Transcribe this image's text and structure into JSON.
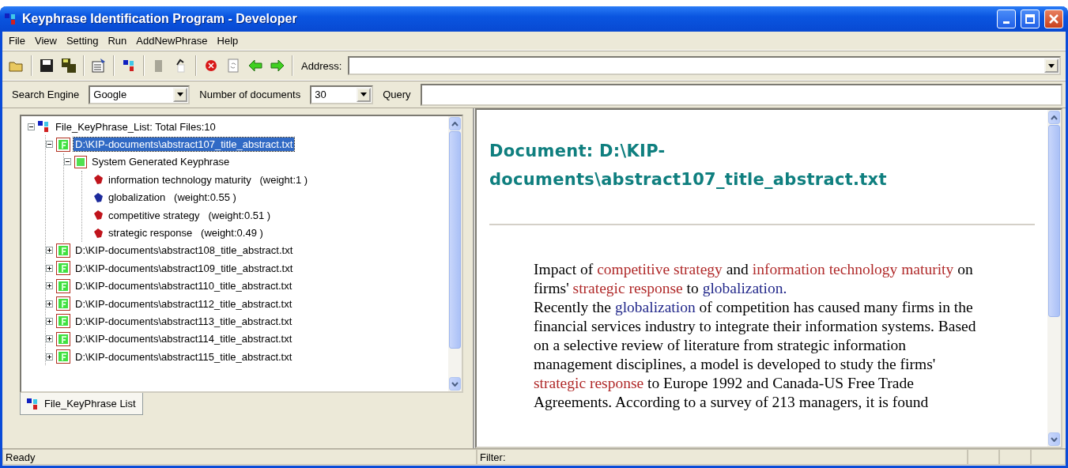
{
  "window": {
    "title": "Keyphrase Identification Program - Developer"
  },
  "menu": [
    "File",
    "View",
    "Setting",
    "Run",
    "AddNewPhrase",
    "Help"
  ],
  "address": {
    "label": "Address:"
  },
  "search": {
    "engine_label": "Search Engine",
    "engine": "Google",
    "count_label": "Number of documents",
    "count": "30",
    "query_label": "Query"
  },
  "tree": {
    "label": "File_KeyPhrase_List: Total Files:10",
    "expanded": true,
    "children": [
      {
        "kind": "file",
        "label": "D:\\KIP-documents\\abstract107_title_abstract.txt",
        "expanded": true,
        "selected": true,
        "children": [
          {
            "kind": "group",
            "label": "System Generated Keyphrase",
            "expanded": true,
            "selected": false,
            "children": [
              {
                "kind": "keyphrase",
                "label": "information technology maturity   (weight:1 )",
                "color": "#c0141c",
                "selected": false
              },
              {
                "kind": "keyphrase",
                "label": "globalization   (weight:0.55 )",
                "color": "#1c2a9c",
                "selected": false
              },
              {
                "kind": "keyphrase",
                "label": "competitive strategy   (weight:0.51 )",
                "color": "#c0141c",
                "selected": false
              },
              {
                "kind": "keyphrase",
                "label": "strategic response   (weight:0.49 )",
                "color": "#c0141c",
                "selected": false
              }
            ]
          }
        ]
      },
      {
        "kind": "file",
        "label": "D:\\KIP-documents\\abstract108_title_abstract.txt",
        "expanded": false,
        "selected": false
      },
      {
        "kind": "file",
        "label": "D:\\KIP-documents\\abstract109_title_abstract.txt",
        "expanded": false,
        "selected": false
      },
      {
        "kind": "file",
        "label": "D:\\KIP-documents\\abstract110_title_abstract.txt",
        "expanded": false,
        "selected": false
      },
      {
        "kind": "file",
        "label": "D:\\KIP-documents\\abstract112_title_abstract.txt",
        "expanded": false,
        "selected": false
      },
      {
        "kind": "file",
        "label": "D:\\KIP-documents\\abstract113_title_abstract.txt",
        "expanded": false,
        "selected": false
      },
      {
        "kind": "file",
        "label": "D:\\KIP-documents\\abstract114_title_abstract.txt",
        "expanded": false,
        "selected": false
      },
      {
        "kind": "file",
        "label": "D:\\KIP-documents\\abstract115_title_abstract.txt",
        "expanded": false,
        "selected": false
      }
    ]
  },
  "tabs": [
    {
      "label": "File_KeyPhrase List",
      "selected": true
    }
  ],
  "document": {
    "heading": "Document: D:\\KIP-documents\\abstract107_title_abstract.txt",
    "paragraphs": [
      [
        {
          "text": "Impact of "
        },
        {
          "text": "competitive strategy",
          "color": "#b02a2a"
        },
        {
          "text": " and "
        },
        {
          "text": "information technology maturity",
          "color": "#b02a2a"
        },
        {
          "text": " on firms' "
        },
        {
          "text": "strategic response",
          "color": "#b02a2a"
        },
        {
          "text": " to "
        },
        {
          "text": "globalization.",
          "color": "#22288a"
        }
      ],
      [
        {
          "text": "Recently the "
        },
        {
          "text": "globalization",
          "color": "#22288a"
        },
        {
          "text": " of competition has caused many firms in the financial services industry to integrate their information systems. Based on a selective review of literature from strategic information management disciplines, a model is developed to study the firms' "
        },
        {
          "text": "strategic response",
          "color": "#b02a2a"
        },
        {
          "text": " to Europe 1992 and Canada-US Free Trade Agreements. According to a survey of 213 managers, it is found"
        }
      ]
    ]
  },
  "status": {
    "left": "Ready",
    "right": "Filter:"
  }
}
